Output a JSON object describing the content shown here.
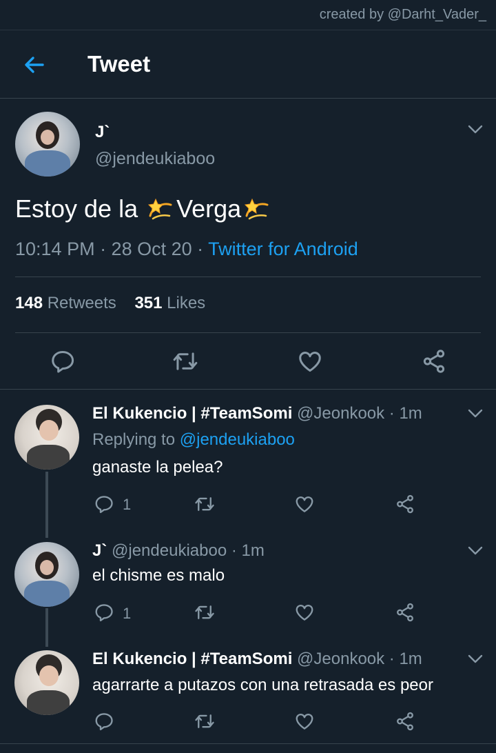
{
  "watermark": "created by @Darht_Vader_",
  "header": {
    "title": "Tweet"
  },
  "tweet": {
    "author_name": "J`",
    "author_handle": "@jendeukiaboo",
    "text_part1": "Estoy de la ",
    "text_part2": "Verga",
    "emoji_name": "dizzy-emoji",
    "time": "10:14 PM · 28 Oct 20 · ",
    "source": "Twitter for Android",
    "retweets_count": "148",
    "retweets_label": "Retweets",
    "likes_count": "351",
    "likes_label": "Likes"
  },
  "replies": [
    {
      "author_name": "El Kukencio | #TeamSomi",
      "author_handle": "@Jeonkook · 1m",
      "replying_prefix": "Replying to ",
      "replying_handle": "@jendeukiaboo",
      "text": "ganaste la pelea?",
      "reply_count": "1"
    },
    {
      "author_name": "J`",
      "author_handle": "@jendeukiaboo · 1m",
      "text": "el chisme es malo",
      "reply_count": "1"
    },
    {
      "author_name": "El Kukencio | #TeamSomi",
      "author_handle": "@Jeonkook · 1m",
      "text": "agarrarte a putazos con una retrasada es peor",
      "reply_count": ""
    }
  ],
  "colors": {
    "background": "#15202b",
    "accent": "#1da1f2",
    "muted": "#8899a6",
    "divider": "#38444d"
  },
  "icons": [
    "back-arrow-icon",
    "chevron-down-icon",
    "reply-icon",
    "retweet-icon",
    "like-icon",
    "share-icon",
    "dizzy-emoji"
  ]
}
